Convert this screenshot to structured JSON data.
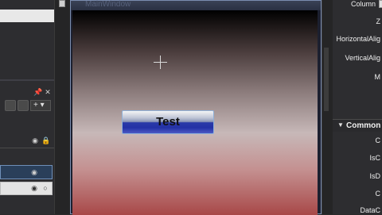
{
  "design_window": {
    "title": "MainWindow",
    "button_label": "Test",
    "gradient_colors": [
      "#000000",
      "#c7b8b8",
      "#a84848"
    ]
  },
  "properties": {
    "rows": [
      "Column",
      "Z",
      "HorizontalAlig",
      "VerticalAlig",
      "M"
    ],
    "common_section": "Common",
    "common_rows": [
      "C",
      "IsC",
      "IsD",
      "C",
      "DataC"
    ]
  },
  "left_panel": {
    "add_label": "+"
  },
  "icons": [
    "pin-icon",
    "close-icon",
    "eye-icon",
    "lock-icon",
    "document-icon",
    "crosshair-cursor-icon",
    "expand-triangle-icon"
  ]
}
